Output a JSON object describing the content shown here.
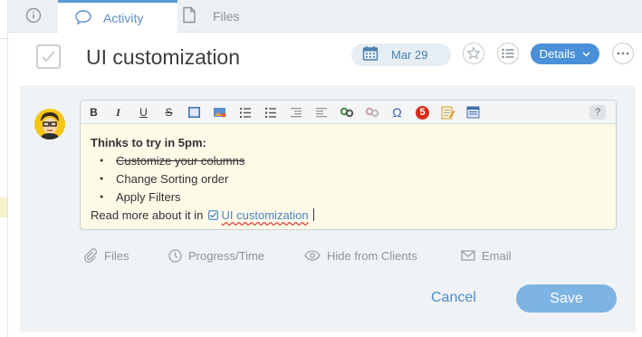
{
  "tabs": [
    {
      "icon": "info-icon",
      "label": ""
    },
    {
      "icon": "chat-bubble-icon",
      "label": "Activity"
    },
    {
      "icon": "file-icon",
      "label": "Files"
    }
  ],
  "task": {
    "title": "UI customization",
    "due_date": "Mar 29",
    "details_label": "Details"
  },
  "editor": {
    "toolbar": {
      "bold": "B",
      "italic": "I",
      "underline": "U",
      "strike": "S",
      "help": "?",
      "omega": "Ω",
      "five": "5"
    },
    "content": {
      "heading": "Thinks to try in 5pm:",
      "items": [
        "Customize your columns",
        "Change Sorting order",
        "Apply Filters"
      ],
      "read_more_prefix": "Read more about it in",
      "link_label": "UI customization"
    }
  },
  "actions": {
    "files": "Files",
    "progress": "Progress/Time",
    "hide": "Hide from Clients",
    "email": "Email"
  },
  "buttons": {
    "cancel": "Cancel",
    "save": "Save"
  },
  "colors": {
    "accent": "#4a90d9",
    "save_button": "#7eb4e4",
    "editor_bg": "#fdfae8",
    "panel_bg": "#f0f3f5"
  }
}
